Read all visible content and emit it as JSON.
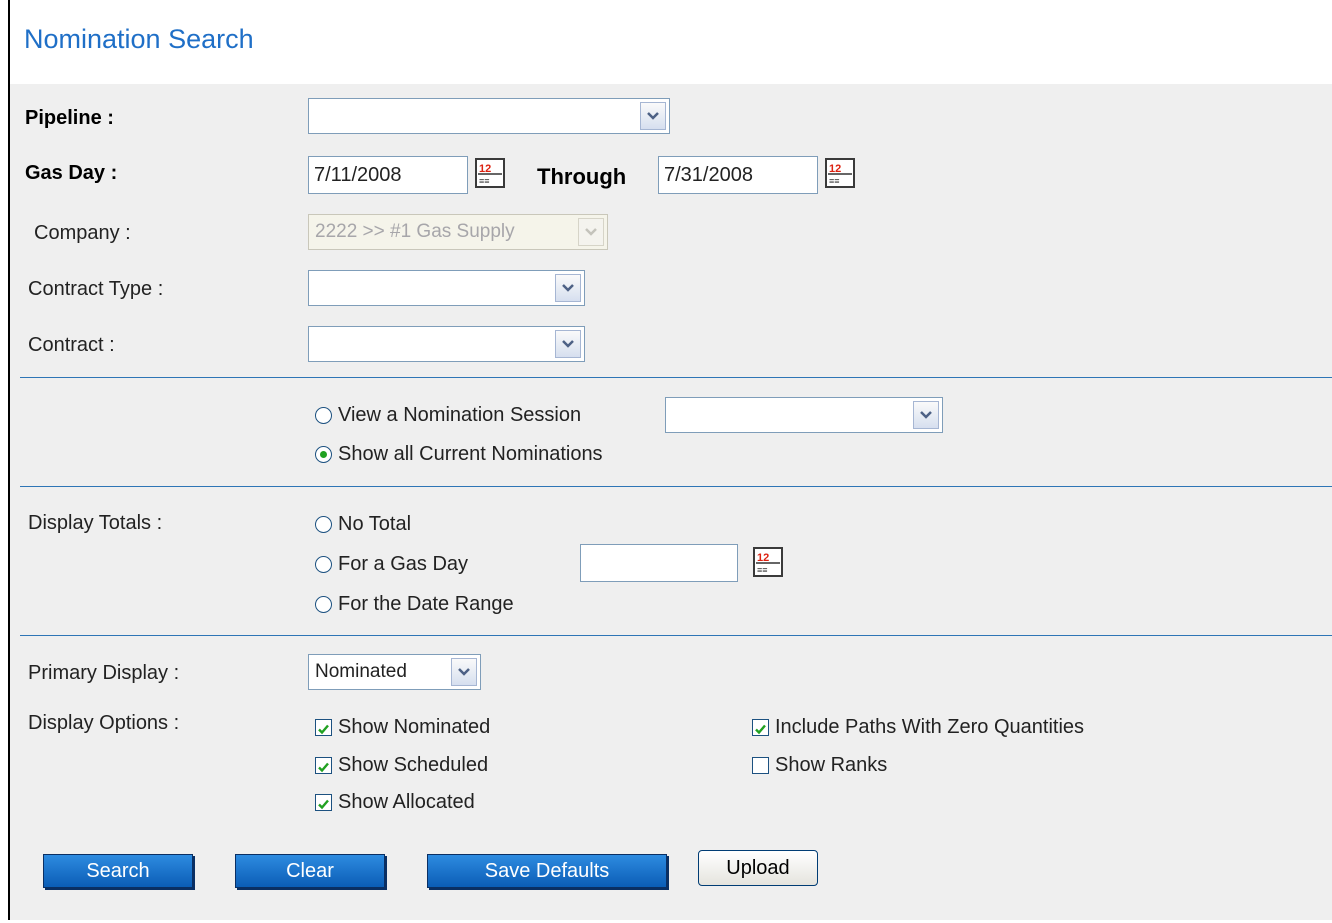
{
  "page": {
    "title": "Nomination Search"
  },
  "form": {
    "pipeline": {
      "label": "Pipeline :",
      "value": ""
    },
    "gas_day": {
      "label": "Gas Day :",
      "from": "7/11/2008",
      "through_label": "Through",
      "to": "7/31/2008"
    },
    "company": {
      "label": "Company :",
      "value": "2222 >> #1 Gas Supply"
    },
    "contract_type": {
      "label": "Contract Type :",
      "value": ""
    },
    "contract": {
      "label": "Contract :",
      "value": ""
    }
  },
  "session": {
    "view_session_label": "View a Nomination Session",
    "session_value": "",
    "show_all_label": "Show all Current Nominations",
    "selected": "show_all"
  },
  "totals": {
    "label": "Display Totals :",
    "no_total_label": "No Total",
    "gas_day_label": "For a Gas Day",
    "gas_day_value": "",
    "date_range_label": "For the Date Range"
  },
  "display": {
    "primary_label": "Primary Display :",
    "primary_value": "Nominated",
    "options_label": "Display Options :",
    "options": [
      {
        "label": "Show Nominated",
        "checked": true
      },
      {
        "label": "Show Scheduled",
        "checked": true
      },
      {
        "label": "Show Allocated",
        "checked": true
      },
      {
        "label": "Include Paths With Zero Quantities",
        "checked": true
      },
      {
        "label": "Show Ranks",
        "checked": false
      }
    ]
  },
  "buttons": {
    "search": "Search",
    "clear": "Clear",
    "save_defaults": "Save Defaults",
    "upload": "Upload"
  },
  "icons": {
    "calendar": "calendar-icon",
    "dropdown": "chevron-down-icon",
    "check": "checkmark-icon"
  },
  "colors": {
    "title": "#1f6fc7",
    "divider": "#2e75b6",
    "button": "#0b5db6",
    "check": "#21a121",
    "panel": "#efefef"
  }
}
